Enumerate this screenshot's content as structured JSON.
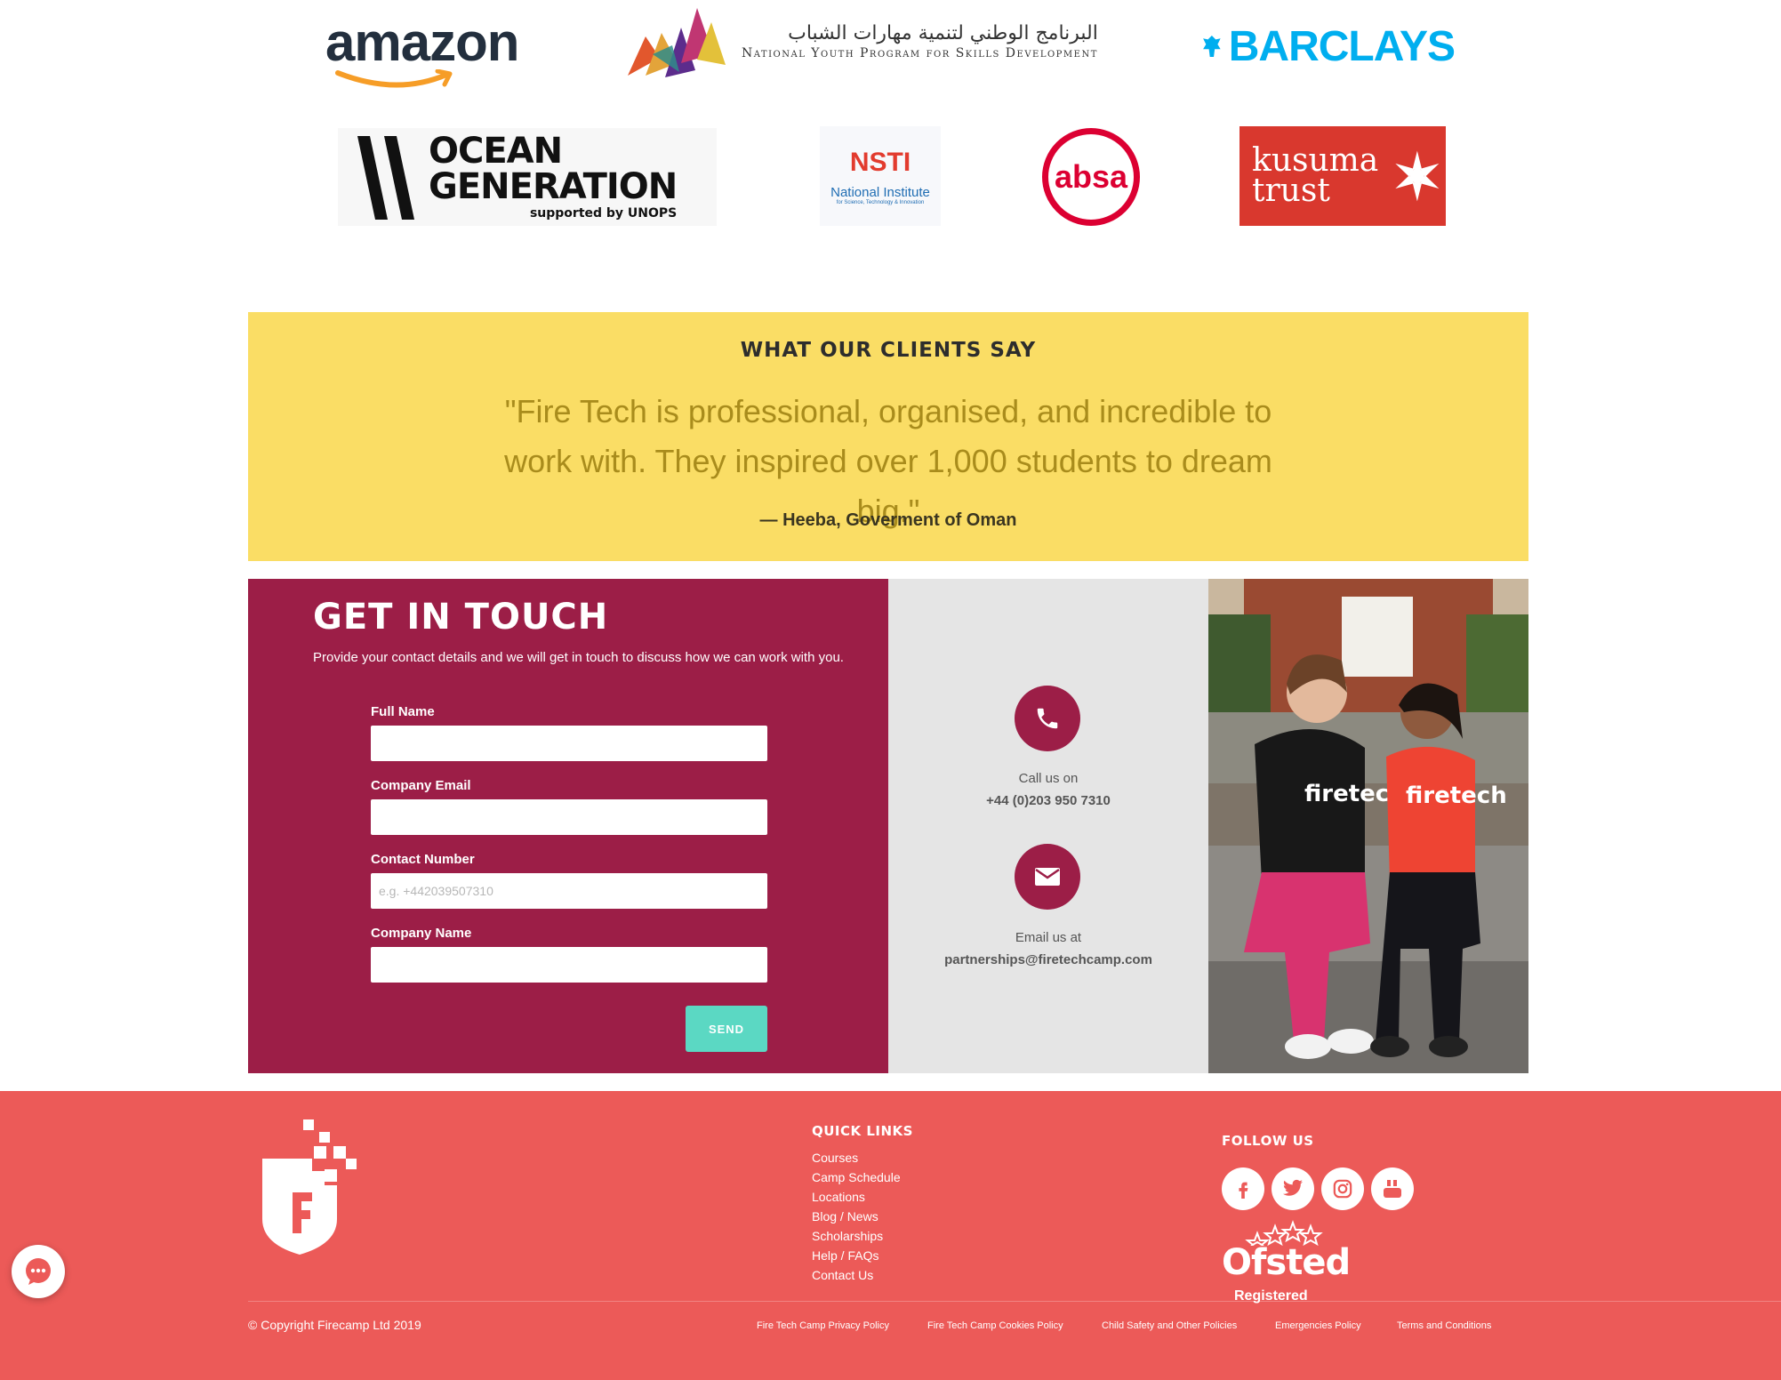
{
  "logos": {
    "amazon": "amazon",
    "nyp_arabic": "البرنامج الوطني لتنمية مهارات الشباب",
    "nyp_english": "National Youth Program for Skills Development",
    "barclays": "BARCLAYS",
    "ocean_line1": "OCEAN",
    "ocean_line2": "GENERATION",
    "ocean_line3": "supported by UNOPS",
    "nsti_big": "NSTI",
    "nsti_sub": "National Institute",
    "nsti_tiny": "for Science, Technology & Innovation",
    "absa": "absa",
    "kusuma_line1": "kusuma",
    "kusuma_line2": "trust"
  },
  "testimonial": {
    "heading": "WHAT OUR CLIENTS SAY",
    "quote": "\"Fire Tech is professional, organised, and incredible to work with. They inspired over 1,000 students to dream big.\"",
    "author": "— Heeba, Goverment of Oman"
  },
  "contact": {
    "title": "GET IN TOUCH",
    "intro": "Provide your contact details and we will get in touch to discuss how we can work with you.",
    "fields": {
      "full_name": {
        "label": "Full Name",
        "value": "",
        "placeholder": ""
      },
      "company_email": {
        "label": "Company Email",
        "value": "",
        "placeholder": ""
      },
      "contact_number": {
        "label": "Contact Number",
        "value": "",
        "placeholder": "e.g. +442039507310"
      },
      "company_name": {
        "label": "Company Name",
        "value": "",
        "placeholder": ""
      }
    },
    "send_label": "SEND",
    "call_label": "Call us on",
    "phone": "+44 (0)203 950 7310",
    "email_label": "Email us at",
    "email": "partnerships@firetechcamp.com",
    "photo_shirt_text_1": "firetech",
    "photo_shirt_text_2": "firetech"
  },
  "footer": {
    "quick_links_title": "QUICK LINKS",
    "quick_links": [
      "Courses",
      "Camp Schedule",
      "Locations",
      "Blog / News",
      "Scholarships",
      "Help / FAQs",
      "Contact Us"
    ],
    "follow_title": "FOLLOW US",
    "social_icons": [
      "facebook-icon",
      "twitter-icon",
      "instagram-icon",
      "youtube-icon"
    ],
    "ofsted_word": "Ofsted",
    "ofsted_reg": "Registered",
    "copyright": "© Copyright Firecamp Ltd 2019",
    "policies": [
      "Fire Tech Camp Privacy Policy",
      "Fire Tech Camp Cookies Policy",
      "Child Safety and Other Policies",
      "Emergencies Policy",
      "Terms and Conditions"
    ]
  },
  "colors": {
    "accent_maroon": "#9c1e47",
    "testimonial_yellow": "#fadd65",
    "footer_red": "#ec5a58",
    "send_teal": "#5bd8c3"
  }
}
